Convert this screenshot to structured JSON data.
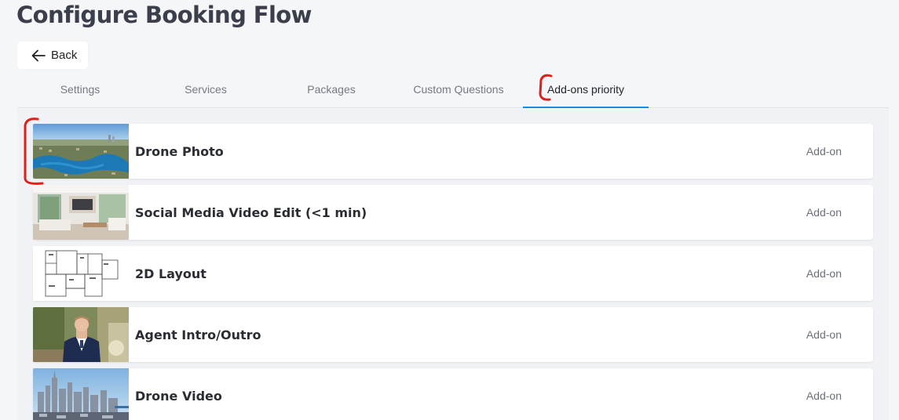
{
  "page": {
    "title": "Configure Booking Flow"
  },
  "back": {
    "label": "Back"
  },
  "tabs": [
    {
      "label": "Settings"
    },
    {
      "label": "Services"
    },
    {
      "label": "Packages"
    },
    {
      "label": "Custom Questions"
    },
    {
      "label": "Add-ons priority"
    }
  ],
  "active_tab": "Add-ons priority",
  "addons": [
    {
      "name": "Drone Photo",
      "type": "Add-on",
      "thumbnail": "aerial-lake-photo"
    },
    {
      "name": "Social Media Video Edit (<1 min)",
      "type": "Add-on",
      "thumbnail": "living-room-photo"
    },
    {
      "name": "2D Layout",
      "type": "Add-on",
      "thumbnail": "floor-plan-drawing"
    },
    {
      "name": "Agent Intro/Outro",
      "type": "Add-on",
      "thumbnail": "agent-portrait-photo"
    },
    {
      "name": "Drone Video",
      "type": "Add-on",
      "thumbnail": "city-skyline-photo"
    }
  ],
  "colors": {
    "accent": "#1e88e5",
    "annotation": "#e0201a",
    "background": "#f4f6f8"
  }
}
